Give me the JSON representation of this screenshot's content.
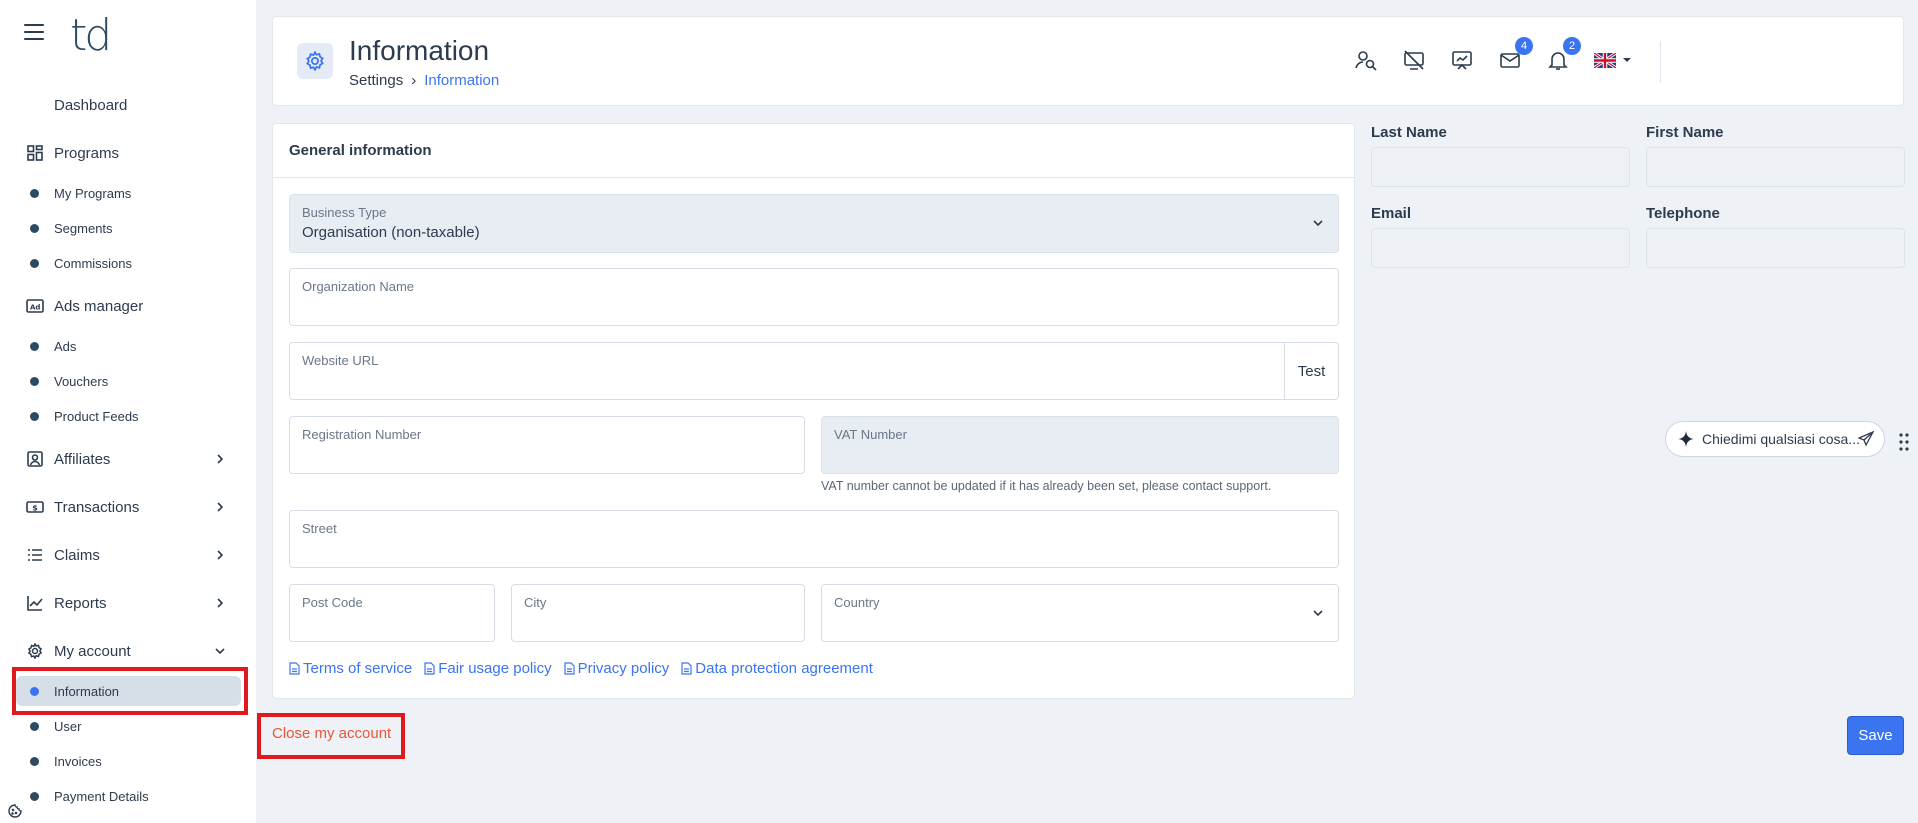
{
  "logo": "td",
  "sidebar": {
    "dashboard": "Dashboard",
    "programs": {
      "label": "Programs",
      "items": [
        "My Programs",
        "Segments",
        "Commissions"
      ]
    },
    "ads_manager": {
      "label": "Ads manager",
      "items": [
        "Ads",
        "Vouchers",
        "Product Feeds"
      ]
    },
    "affiliates": "Affiliates",
    "transactions": "Transactions",
    "claims": "Claims",
    "reports": "Reports",
    "my_account": {
      "label": "My account",
      "items": [
        "Information",
        "User",
        "Invoices",
        "Payment Details"
      ]
    }
  },
  "header": {
    "title": "Information",
    "breadcrumb": {
      "parent": "Settings",
      "separator": "›",
      "current": "Information"
    },
    "mail_badge": "4",
    "notifications_badge": "2"
  },
  "form": {
    "section_title": "General information",
    "business_type": {
      "label": "Business Type",
      "value": "Organisation (non-taxable)"
    },
    "organization_name": {
      "label": "Organization Name",
      "value": ""
    },
    "website_url": {
      "label": "Website URL",
      "value": "",
      "test_label": "Test"
    },
    "registration_number": {
      "label": "Registration Number",
      "value": ""
    },
    "vat_number": {
      "label": "VAT Number",
      "value": "",
      "note": "VAT number cannot be updated if it has already been set, please contact support."
    },
    "street": {
      "label": "Street",
      "value": ""
    },
    "post_code": {
      "label": "Post Code",
      "value": ""
    },
    "city": {
      "label": "City",
      "value": ""
    },
    "country": {
      "label": "Country",
      "value": ""
    },
    "links": [
      "Terms of service",
      "Fair usage policy",
      "Privacy policy",
      "Data protection agreement"
    ]
  },
  "contact": {
    "last_name": "Last Name",
    "first_name": "First Name",
    "email": "Email",
    "telephone": "Telephone"
  },
  "chat": {
    "placeholder": "Chiedimi qualsiasi cosa..."
  },
  "actions": {
    "close_account": "Close my account",
    "save": "Save"
  },
  "colors": {
    "accent": "#3b74f0",
    "danger": "#e8553a",
    "highlight": "#e0191f"
  }
}
